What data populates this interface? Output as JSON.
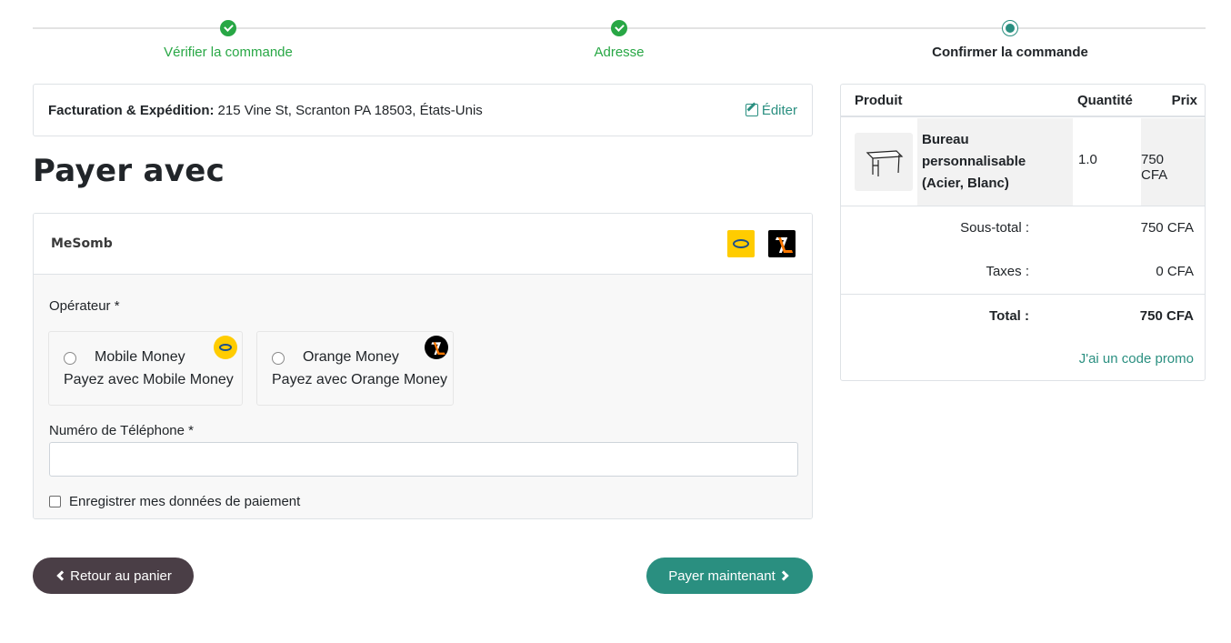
{
  "wizard": {
    "steps": [
      {
        "label": "Vérifier la commande",
        "state": "done"
      },
      {
        "label": "Adresse",
        "state": "done"
      },
      {
        "label": "Confirmer la commande",
        "state": "current"
      }
    ]
  },
  "billing": {
    "label": "Facturation & Expédition:",
    "address": "215 Vine St, Scranton PA 18503, États-Unis",
    "edit_label": "Éditer"
  },
  "payment": {
    "title": "Payer avec",
    "provider_name": "MeSomb",
    "operator_label": "Opérateur *",
    "operators": [
      {
        "name": "Mobile Money",
        "description": "Payez avec Mobile Money",
        "icon": "mtn-momo-logo"
      },
      {
        "name": "Orange Money",
        "description": "Payez avec Orange Money",
        "icon": "orange-money-logo"
      }
    ],
    "phone_label": "Numéro de Téléphone *",
    "phone_value": "",
    "save_label": "Enregistrer mes données de paiement"
  },
  "buttons": {
    "back_label": "Retour au panier",
    "pay_label": "Payer maintenant"
  },
  "summary": {
    "headers": {
      "product": "Produit",
      "quantity": "Quantité",
      "price": "Prix"
    },
    "items": [
      {
        "name": "Bureau personnalisable (Acier, Blanc)",
        "quantity": "1.0",
        "price": "750 CFA"
      }
    ],
    "subtotal_label": "Sous-total :",
    "subtotal_value": "750 CFA",
    "taxes_label": "Taxes :",
    "taxes_value": "0 CFA",
    "total_label": "Total :",
    "total_value": "750 CFA",
    "promo_label": "J'ai un code promo"
  },
  "colors": {
    "accent": "#2a8f80",
    "success": "#28a745",
    "back_button": "#4a3e46"
  }
}
